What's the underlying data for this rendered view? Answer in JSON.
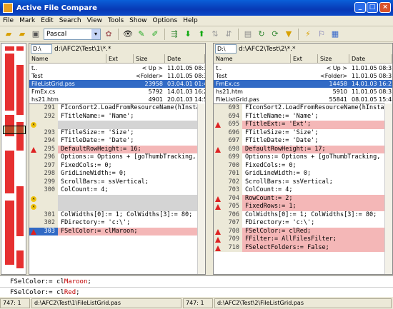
{
  "window": {
    "title": "Active File Compare",
    "btn_min": "_",
    "btn_max": "□",
    "btn_close": "×"
  },
  "menu": [
    "File",
    "Mark",
    "Edit",
    "Search",
    "View",
    "Tools",
    "Show",
    "Options",
    "Help"
  ],
  "toolbar": {
    "font": "Pascal"
  },
  "left": {
    "drive": "D:\\",
    "path": "d:\\AFC2\\Test\\1\\*.*",
    "headers": [
      "Name",
      "Ext",
      "Size",
      "Date"
    ],
    "files": [
      {
        "name": "t..",
        "ext": "",
        "size": "< Up >",
        "date": "11.01.05 08:33"
      },
      {
        "name": "Test",
        "ext": "",
        "size": "<Folder>",
        "date": "11.01.05 08:33"
      },
      {
        "name": "FileListGrid.pas",
        "ext": "",
        "size": "23958",
        "date": "03.04.01 01:46"
      },
      {
        "name": "FmEx.cs",
        "ext": "",
        "size": "5792",
        "date": "14.01.03 16:23"
      },
      {
        "name": "hs21.htm",
        "ext": "",
        "size": "4901",
        "date": "20.01.03 14:55"
      }
    ],
    "lines": [
      {
        "n": "291",
        "t": "FIconSort2.LoadFromResourceName(hInsta"
      },
      {
        "n": "292",
        "t": "FTitleName:= 'Name';"
      },
      {
        "n": "",
        "t": ""
      },
      {
        "n": "293",
        "t": "FTitleSize:= 'Size';"
      },
      {
        "n": "294",
        "t": "FTitleDate:= 'Date';"
      },
      {
        "n": "295",
        "t": "DefaultRowHeight:= 16;"
      },
      {
        "n": "296",
        "t": "Options:= Options + [goThumbTracking, g"
      },
      {
        "n": "297",
        "t": "FixedCols:= 0;"
      },
      {
        "n": "298",
        "t": "GridLineWidth:= 0;"
      },
      {
        "n": "299",
        "t": "ScrollBars:= ssVertical;"
      },
      {
        "n": "300",
        "t": "ColCount:= 4;"
      },
      {
        "n": "",
        "t": ""
      },
      {
        "n": "",
        "t": ""
      },
      {
        "n": "301",
        "t": "ColWidths[0]:= 1; ColWidths[3]:= 80;"
      },
      {
        "n": "302",
        "t": "FDirectory:= 'c:\\';"
      },
      {
        "n": "303",
        "t": "FSelColor:= clMaroon;"
      }
    ]
  },
  "right": {
    "drive": "D:\\",
    "path": "d:\\AFC2\\Test\\2\\*.*",
    "headers": [
      "Name",
      "Ext",
      "Size",
      "Date"
    ],
    "files": [
      {
        "name": "t..",
        "ext": "",
        "size": "< Up >",
        "date": "11.01.05 08:33"
      },
      {
        "name": "Test",
        "ext": "",
        "size": "<Folder>",
        "date": "11.01.05 08:33"
      },
      {
        "name": "FmEx.cs",
        "ext": "",
        "size": "14458",
        "date": "14.01.03 16:23"
      },
      {
        "name": "hs21.htm",
        "ext": "",
        "size": "5910",
        "date": "11.01.05 08:33"
      },
      {
        "name": "FileListGrid.pas",
        "ext": "",
        "size": "55841",
        "date": "08.01.05 15:48"
      }
    ],
    "lines": [
      {
        "n": "693",
        "t": "FIconSort2.LoadFromResourceName(hInsta"
      },
      {
        "n": "694",
        "t": "FTitleName:= 'Name';"
      },
      {
        "n": "695",
        "t": "FTitleExt:= 'Ext';"
      },
      {
        "n": "696",
        "t": "FTitleSize:= 'Size';"
      },
      {
        "n": "697",
        "t": "FTitleDate:= 'Date';"
      },
      {
        "n": "698",
        "t": "DefaultRowHeight:= 17;"
      },
      {
        "n": "699",
        "t": "Options:= Options + [goThumbTracking,"
      },
      {
        "n": "700",
        "t": "FixedCols:= 0;"
      },
      {
        "n": "701",
        "t": "GridLineWidth:= 0;"
      },
      {
        "n": "702",
        "t": "ScrollBars:= ssVertical;"
      },
      {
        "n": "703",
        "t": "ColCount:= 4;"
      },
      {
        "n": "704",
        "t": "RowCount:= 2;"
      },
      {
        "n": "705",
        "t": "FixedRows:= 1;"
      },
      {
        "n": "706",
        "t": "ColWidths[0]:= 1; ColWidths[3]:= 80;"
      },
      {
        "n": "707",
        "t": "FDirectory:= 'c:\\';"
      },
      {
        "n": "708",
        "t": "FSelColor:= clRed;"
      },
      {
        "n": "709",
        "t": "FFilter:= AllFilesFilter;"
      },
      {
        "n": "710",
        "t": "FSelectFolders:= False;"
      }
    ]
  },
  "bottom": {
    "line1_a": "FSelColor:= cl",
    "line1_b": "Maroon",
    "line1_c": ";",
    "line2_a": "FSelColor:= cl",
    "line2_b": "Red",
    "line2_c": ";"
  },
  "status": {
    "left_pos": "747: 1",
    "left_file": "d:\\AFC2\\Test\\1\\FileListGrid.pas",
    "right_pos": "747: 1",
    "right_file": "d:\\AFC2\\Test\\2\\FileListGrid.pas"
  }
}
